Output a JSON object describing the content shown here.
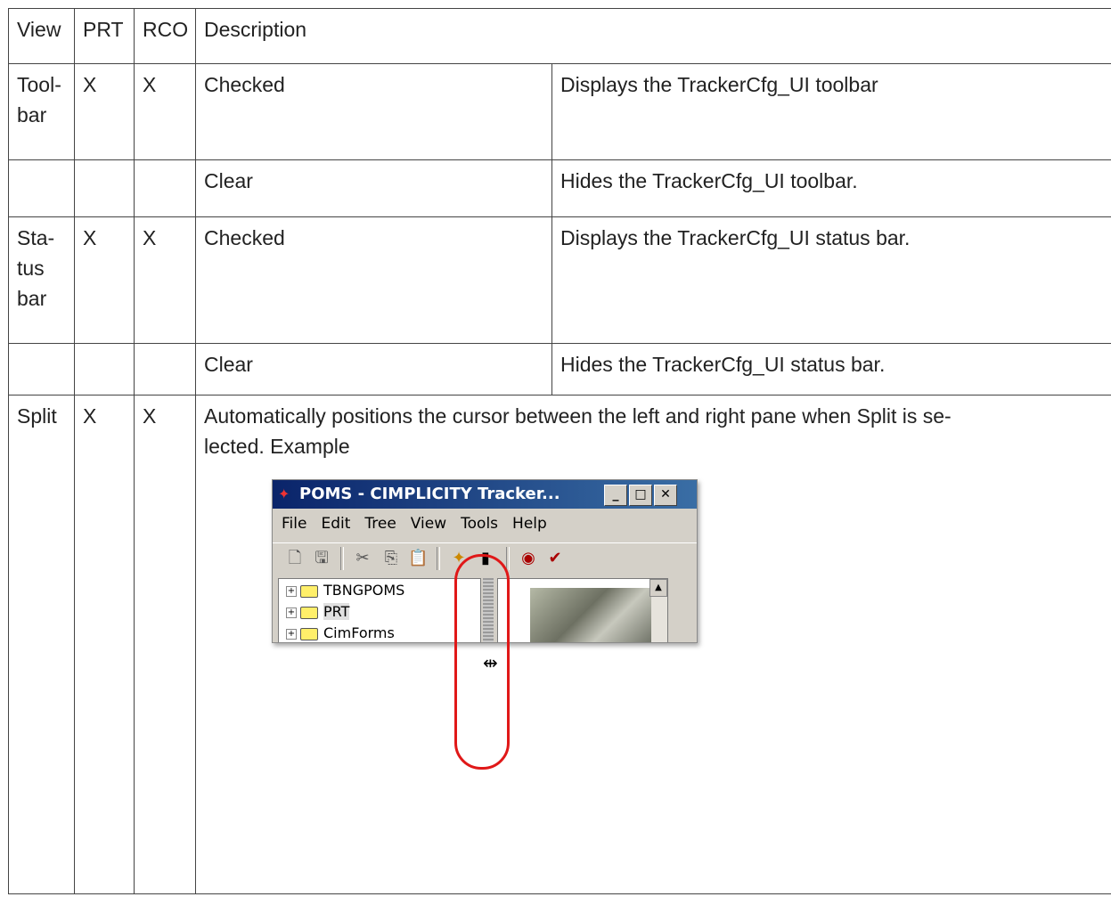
{
  "header": {
    "view": "View",
    "prt": "PRT",
    "rco": "RCO",
    "description": "Description"
  },
  "rows": [
    {
      "view": "Tool-\nbar",
      "prt": "X",
      "rco": "X",
      "setting": "Checked",
      "effect": "Displays the TrackerCfg_UI toolbar"
    },
    {
      "view": "",
      "prt": "",
      "rco": "",
      "setting": "Clear",
      "effect": "Hides the TrackerCfg_UI toolbar."
    },
    {
      "view": "Sta-\ntus\nbar",
      "prt": "X",
      "rco": "X",
      "setting": "Checked",
      "effect": "Displays the TrackerCfg_UI status bar."
    },
    {
      "view": "",
      "prt": "",
      "rco": "",
      "setting": "Clear",
      "effect": "Hides the TrackerCfg_UI status bar."
    }
  ],
  "split_row": {
    "view": "Split",
    "prt": "X",
    "rco": "X",
    "description": "Automatically positions the cursor between the left and right pane when Split is se-\nlected. Example"
  },
  "window": {
    "title": "POMS - CIMPLICITY Tracker...",
    "menu": [
      "File",
      "Edit",
      "Tree",
      "View",
      "Tools",
      "Help"
    ],
    "tree": [
      "TBNGPOMS",
      "PRT",
      "CimForms"
    ],
    "selected_index": 1
  }
}
